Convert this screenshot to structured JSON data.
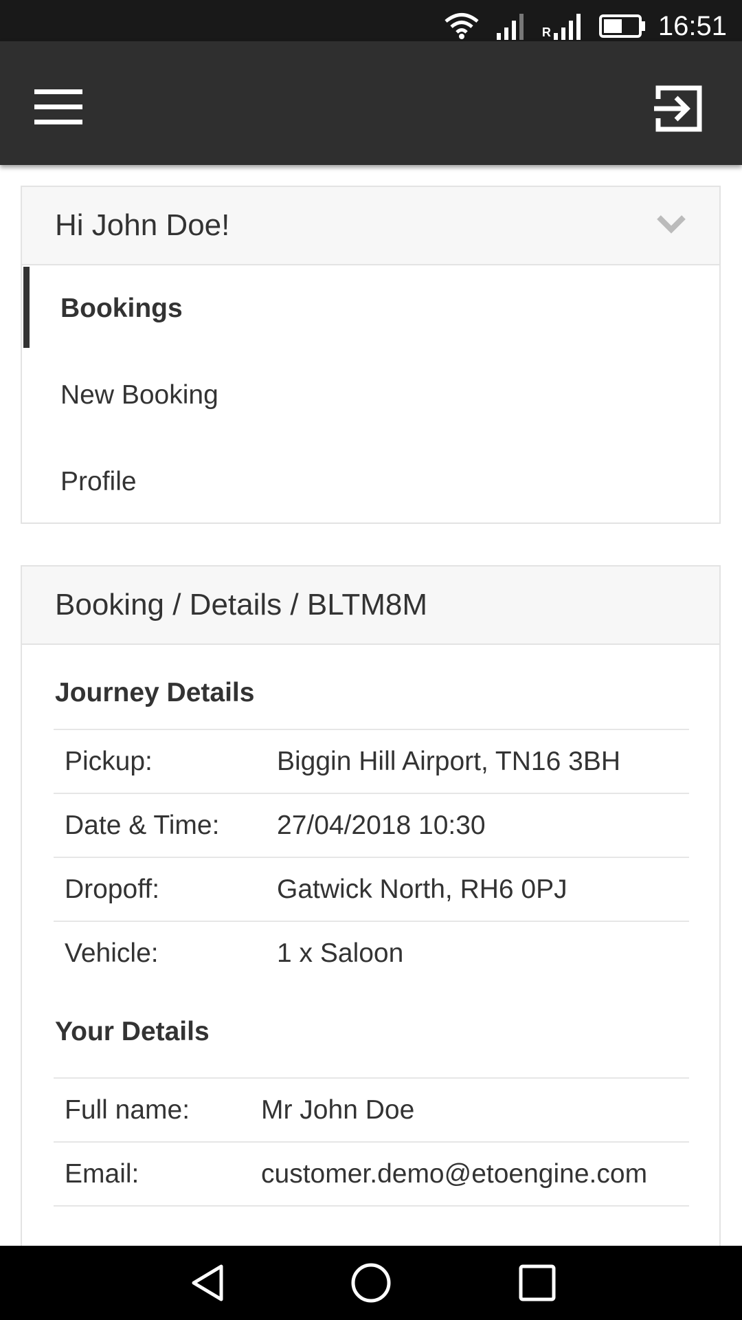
{
  "status_bar": {
    "time": "16:51",
    "roaming_label": "R",
    "icons": [
      "wifi-icon",
      "signal-icon",
      "signal-roaming-icon",
      "battery-icon"
    ]
  },
  "app_bar": {
    "menu_icon": "hamburger-menu-icon",
    "logout_icon": "logout-icon"
  },
  "account_menu": {
    "greeting": "Hi John Doe!",
    "items": [
      {
        "label": "Bookings",
        "active": true
      },
      {
        "label": "New Booking",
        "active": false
      },
      {
        "label": "Profile",
        "active": false
      }
    ]
  },
  "booking": {
    "breadcrumb": "Booking / Details / BLTM8M",
    "journey_title": "Journey Details",
    "journey": [
      {
        "label": "Pickup:",
        "value": "Biggin Hill Airport, TN16 3BH"
      },
      {
        "label": "Date & Time:",
        "value": "27/04/2018 10:30"
      },
      {
        "label": "Dropoff:",
        "value": "Gatwick North, RH6 0PJ"
      },
      {
        "label": "Vehicle:",
        "value": "1 x Saloon"
      }
    ],
    "your_details_title": "Your Details",
    "your_details": [
      {
        "label": "Full name:",
        "value": "Mr John Doe"
      },
      {
        "label": "Email:",
        "value": "customer.demo@etoengine.com"
      }
    ]
  },
  "colors": {
    "app_bar": "#2f2f2f",
    "status_bar": "#191919",
    "header_bg": "#f7f7f7",
    "text": "#333333"
  }
}
